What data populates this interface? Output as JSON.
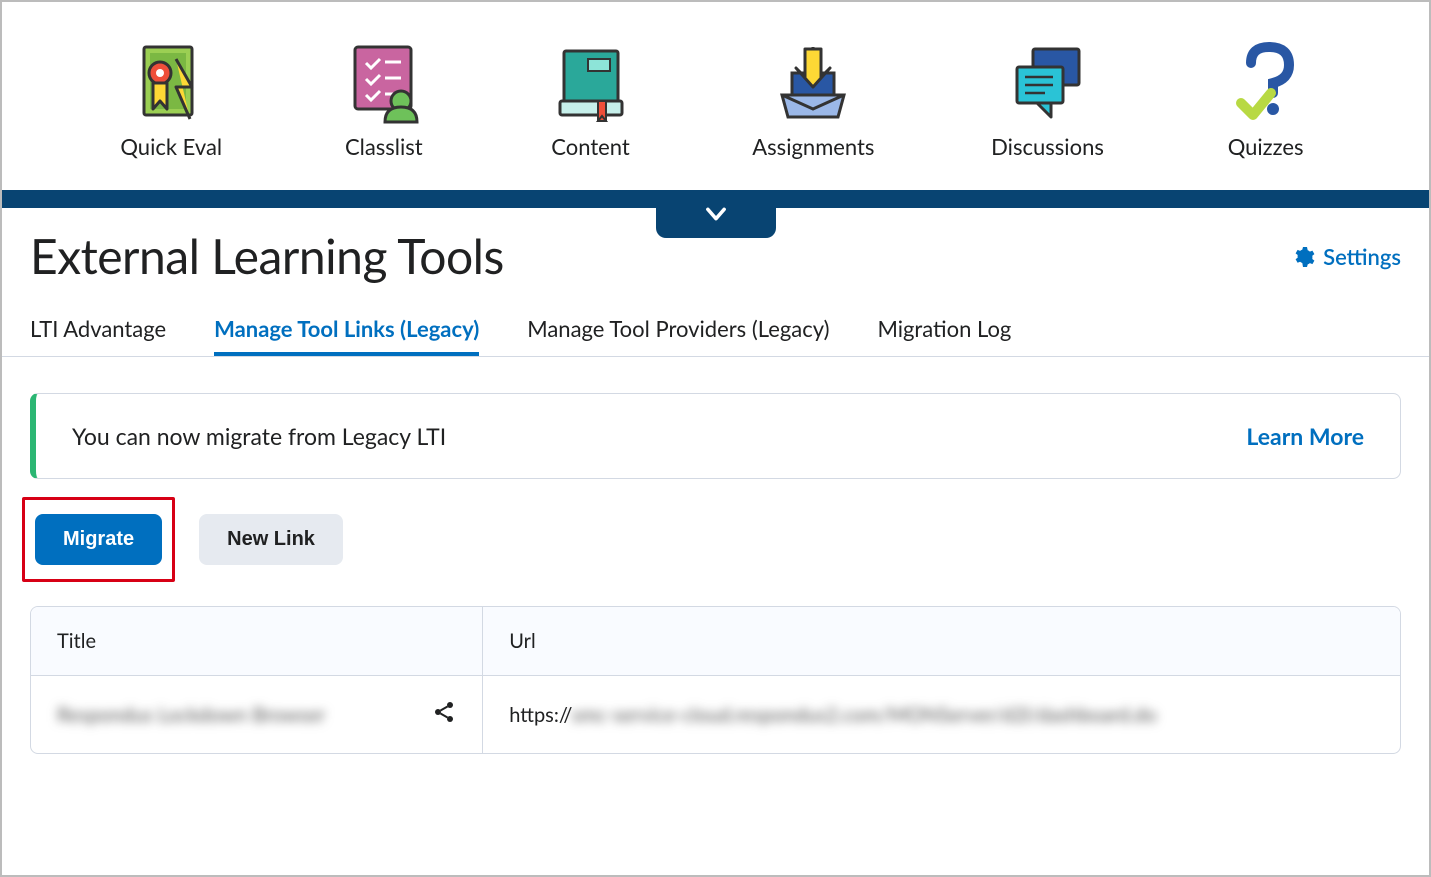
{
  "nav": {
    "items": [
      {
        "label": "Quick Eval"
      },
      {
        "label": "Classlist"
      },
      {
        "label": "Content"
      },
      {
        "label": "Assignments"
      },
      {
        "label": "Discussions"
      },
      {
        "label": "Quizzes"
      }
    ]
  },
  "page": {
    "title": "External Learning Tools",
    "settings_label": "Settings"
  },
  "tabs": [
    {
      "label": "LTI Advantage",
      "active": false
    },
    {
      "label": "Manage Tool Links (Legacy)",
      "active": true
    },
    {
      "label": "Manage Tool Providers (Legacy)",
      "active": false
    },
    {
      "label": "Migration Log",
      "active": false
    }
  ],
  "alert": {
    "message": "You can now migrate from Legacy LTI",
    "learn_more": "Learn More"
  },
  "actions": {
    "migrate": "Migrate",
    "new_link": "New Link"
  },
  "table": {
    "headers": {
      "title": "Title",
      "url": "Url"
    },
    "rows": [
      {
        "title": "Respondus Lockdown Browser",
        "url_prefix": "https://",
        "url_rest": "smc-service-cloud.respondus2.com/MONServer/d2l/dashboard.do"
      }
    ]
  }
}
